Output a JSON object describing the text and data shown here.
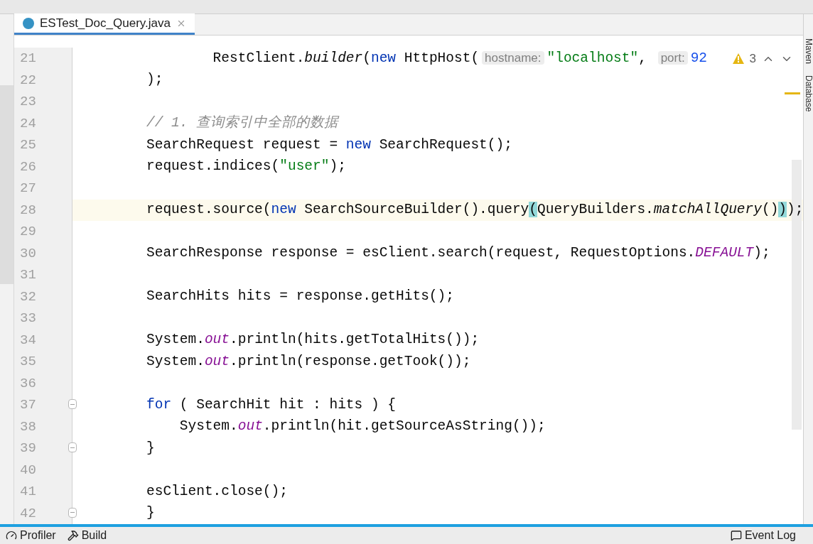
{
  "tab": {
    "title": "ESTest_Doc_Query.java",
    "selected": true
  },
  "inspection": {
    "warnings": "3"
  },
  "lines": [
    {
      "number": "21",
      "current": false,
      "fold": false,
      "tokens": [
        {
          "kind": "plain",
          "text": "        RestClient."
        },
        {
          "kind": "method-italic",
          "text": "builder"
        },
        {
          "kind": "plain",
          "text": "("
        },
        {
          "kind": "keyword",
          "text": "new"
        },
        {
          "kind": "plain",
          "text": " HttpHost("
        },
        {
          "kind": "hint",
          "text": "hostname:"
        },
        {
          "kind": "string",
          "text": "\"localhost\""
        },
        {
          "kind": "plain",
          "text": ", "
        },
        {
          "kind": "hint",
          "text": "port:"
        },
        {
          "kind": "number",
          "text": "92"
        }
      ]
    },
    {
      "number": "22",
      "current": false,
      "fold": false,
      "tokens": [
        {
          "kind": "plain",
          "text": ");"
        }
      ]
    },
    {
      "number": "23",
      "current": false,
      "fold": false
    },
    {
      "number": "24",
      "current": false,
      "fold": false,
      "tokens": [
        {
          "kind": "comment",
          "text": "// 1. 查询索引中全部的数据"
        }
      ]
    },
    {
      "number": "25",
      "current": false,
      "fold": false,
      "tokens": [
        {
          "kind": "plain",
          "text": "SearchRequest request = "
        },
        {
          "kind": "keyword",
          "text": "new"
        },
        {
          "kind": "plain",
          "text": " SearchRequest();"
        }
      ]
    },
    {
      "number": "26",
      "current": false,
      "fold": false,
      "tokens": [
        {
          "kind": "plain",
          "text": "request.indices("
        },
        {
          "kind": "string",
          "text": "\"user\""
        },
        {
          "kind": "plain",
          "text": ");"
        }
      ]
    },
    {
      "number": "27",
      "current": false,
      "fold": false
    },
    {
      "number": "28",
      "current": true,
      "fold": false,
      "tokens": [
        {
          "kind": "plain",
          "text": "request.source("
        },
        {
          "kind": "keyword",
          "text": "new"
        },
        {
          "kind": "plain",
          "text": " SearchSourceBuilder().query"
        },
        {
          "kind": "bracket-match",
          "text": "("
        },
        {
          "kind": "plain",
          "text": "QueryBuilders."
        },
        {
          "kind": "method-italic",
          "text": "matchAllQuery"
        },
        {
          "kind": "plain",
          "text": "()"
        },
        {
          "kind": "bracket-match",
          "text": ")"
        },
        {
          "kind": "plain",
          "text": ");"
        }
      ]
    },
    {
      "number": "29",
      "current": false,
      "fold": false
    },
    {
      "number": "30",
      "current": false,
      "fold": false,
      "tokens": [
        {
          "kind": "plain",
          "text": "SearchResponse response = esClient.search(request, RequestOptions."
        },
        {
          "kind": "static-field",
          "text": "DEFAULT"
        },
        {
          "kind": "plain",
          "text": ");"
        }
      ]
    },
    {
      "number": "31",
      "current": false,
      "fold": false
    },
    {
      "number": "32",
      "current": false,
      "fold": false,
      "tokens": [
        {
          "kind": "plain",
          "text": "SearchHits hits = response.getHits();"
        }
      ]
    },
    {
      "number": "33",
      "current": false,
      "fold": false
    },
    {
      "number": "34",
      "current": false,
      "fold": false,
      "tokens": [
        {
          "kind": "plain",
          "text": "System."
        },
        {
          "kind": "static-field",
          "text": "out"
        },
        {
          "kind": "plain",
          "text": ".println(hits.getTotalHits());"
        }
      ]
    },
    {
      "number": "35",
      "current": false,
      "fold": false,
      "tokens": [
        {
          "kind": "plain",
          "text": "System."
        },
        {
          "kind": "static-field",
          "text": "out"
        },
        {
          "kind": "plain",
          "text": ".println(response.getTook());"
        }
      ]
    },
    {
      "number": "36",
      "current": false,
      "fold": false
    },
    {
      "number": "37",
      "current": false,
      "fold": true,
      "tokens": [
        {
          "kind": "keyword",
          "text": "for"
        },
        {
          "kind": "plain",
          "text": " ( SearchHit hit : hits ) {"
        }
      ]
    },
    {
      "number": "38",
      "current": false,
      "fold": false,
      "tokens": [
        {
          "kind": "plain",
          "text": "    System."
        },
        {
          "kind": "static-field",
          "text": "out"
        },
        {
          "kind": "plain",
          "text": ".println(hit.getSourceAsString());"
        }
      ]
    },
    {
      "number": "39",
      "current": false,
      "fold": true,
      "tokens": [
        {
          "kind": "plain",
          "text": "}"
        }
      ]
    },
    {
      "number": "40",
      "current": false,
      "fold": false
    },
    {
      "number": "41",
      "current": false,
      "fold": false,
      "tokens": [
        {
          "kind": "plain",
          "text": "esClient.close();"
        }
      ]
    },
    {
      "number": "42",
      "current": false,
      "fold": true,
      "tokens": [
        {
          "kind": "plain",
          "text": "}"
        }
      ]
    }
  ],
  "side_tools": [
    "Maven",
    "Database"
  ],
  "bottom_tools": [
    {
      "label": "Profiler",
      "kind": "profiler"
    },
    {
      "label": "Build",
      "kind": "build"
    },
    {
      "label": "Event Log",
      "kind": "event-log"
    }
  ]
}
